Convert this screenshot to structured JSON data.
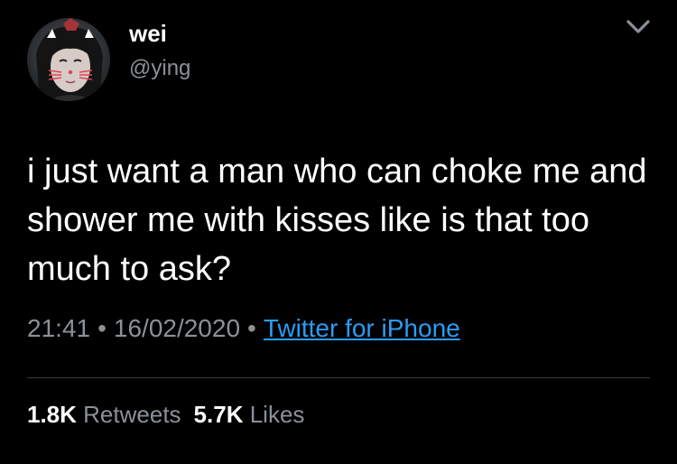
{
  "author": {
    "display_name": "wei",
    "handle": "@ying",
    "avatar_icon": "profile-photo"
  },
  "tweet": {
    "text": "i just want a man who can choke me and shower me with kisses like is that too much to ask?"
  },
  "meta": {
    "time": "21:41",
    "separator": "•",
    "date": "16/02/2020",
    "source": "Twitter for iPhone"
  },
  "stats": {
    "retweets_count": "1.8K",
    "retweets_label": "Retweets",
    "likes_count": "5.7K",
    "likes_label": "Likes"
  },
  "colors": {
    "background": "#000000",
    "text": "#ffffff",
    "secondary_text": "#8a9197",
    "link": "#2a9df4",
    "divider": "#3a3d40"
  }
}
